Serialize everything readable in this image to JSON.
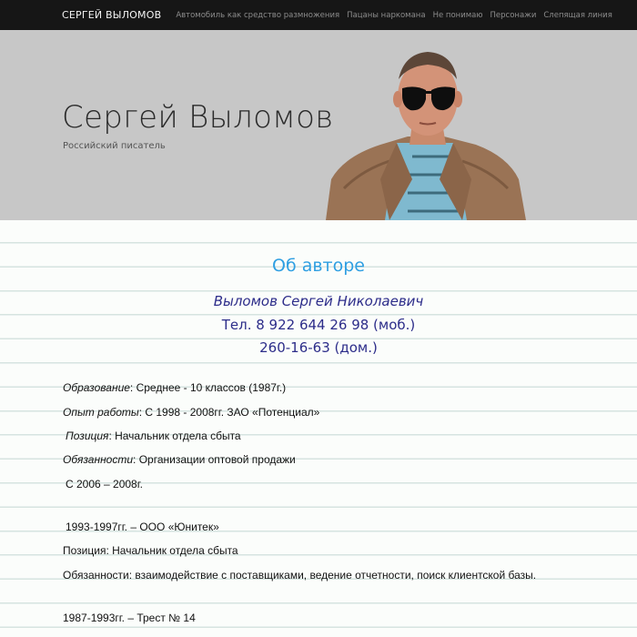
{
  "nav": {
    "brand": "СЕРГЕЙ ВЫЛОМОВ",
    "links": [
      "Автомобиль как средство размножения",
      "Пацаны наркомана",
      "Не понимаю",
      "Персонажи",
      "Слепящая линия"
    ]
  },
  "hero": {
    "title": "Сергей Выломов",
    "subtitle": "Российский писатель"
  },
  "about": {
    "title": "Об авторе",
    "name": "Выломов Сергей Николаевич",
    "phone_mobile": "Тел. 8 922 644 26 98 (моб.)",
    "phone_home": "260-16-63 (дом.)"
  },
  "resume": {
    "education_label": "Образование",
    "education_value": ": Среднее - 10 классов (1987г.)",
    "experience_label": "Опыт работы",
    "experience_value": ":  С 1998 - 2008гг.  ЗАО «Потенциал»",
    "position_label": "Позиция",
    "position_value": ": Начальник отдела сбыта",
    "duties_label": "Обязанности",
    "duties_value": ": Организации оптовой продажи",
    "period_2006": "С 2006 – 2008г.",
    "job2_period": "1993-1997гг. – ООО «Юнитек»",
    "job2_position": "Позиция: Начальник отдела сбыта",
    "job2_duties": "Обязанности: взаимодействие с поставщиками, ведение отчетности, поиск  клиентской базы.",
    "job3_period": "1987-1993гг. – Трест № 14"
  }
}
